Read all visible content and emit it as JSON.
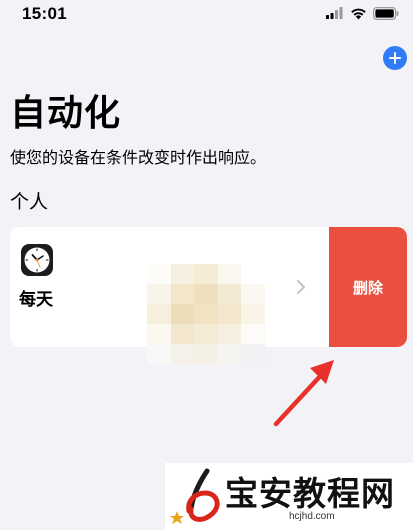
{
  "status_bar": {
    "time": "15:01",
    "icons": [
      "signal-icon",
      "wifi-icon",
      "battery-icon"
    ]
  },
  "header": {
    "add_icon": "plus-icon",
    "title": "自动化",
    "subtitle": "使您的设备在条件改变时作出响应。"
  },
  "section": {
    "title": "个人"
  },
  "automation_item": {
    "icon": "clock-icon",
    "label": "每天",
    "chevron": "chevron-right-icon",
    "delete_label": "删除"
  },
  "watermark": {
    "name": "宝安教程网",
    "url": "hcjhd.com"
  },
  "colors": {
    "background": "#f2f2f7",
    "accent": "#2f7cf6",
    "delete": "#e9503f",
    "arrow": "#e8312a"
  }
}
